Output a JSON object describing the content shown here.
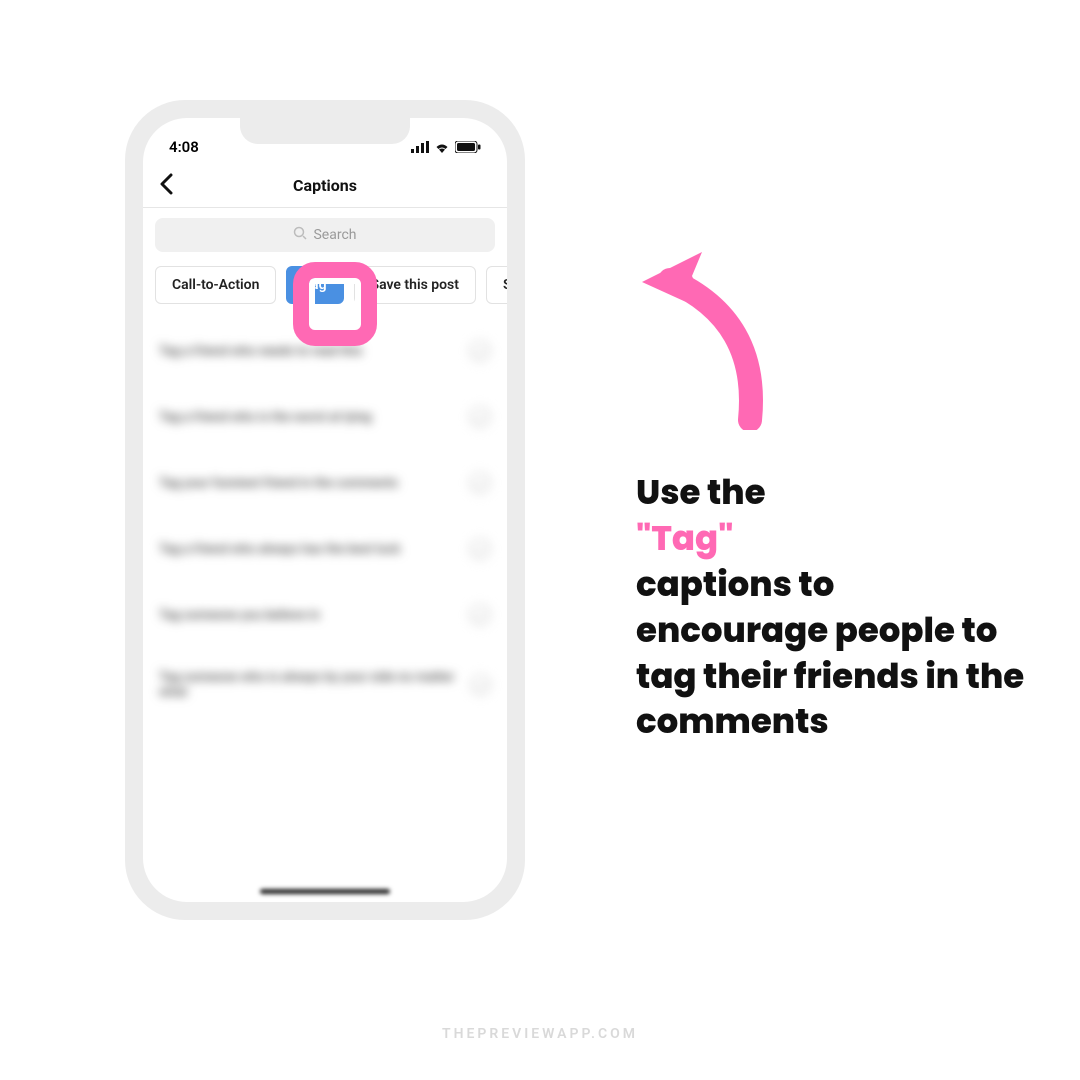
{
  "status": {
    "time": "4:08"
  },
  "nav": {
    "title": "Captions"
  },
  "search": {
    "placeholder": "Search"
  },
  "chips": [
    {
      "label": "Call-to-Action",
      "active": false
    },
    {
      "label": "Tag",
      "active": true
    },
    {
      "label": "Save this post",
      "active": false
    },
    {
      "label": "Share this p",
      "active": false
    }
  ],
  "captions": [
    "Tag a friend who needs to read this",
    "Tag a friend who is the worst at lying",
    "Tag your funniest friend in the comments",
    "Tag a friend who always has the best luck",
    "Tag someone you believe in",
    "Tag someone who is always by your side no matter what"
  ],
  "annotation": {
    "line1": "Use the",
    "highlight": "\"Tag\"",
    "rest": "captions to encourage people to tag their friends in the comments"
  },
  "watermark": "THEPREVIEWAPP.COM",
  "colors": {
    "pink": "#ff69b4",
    "blue": "#4a90e2"
  }
}
